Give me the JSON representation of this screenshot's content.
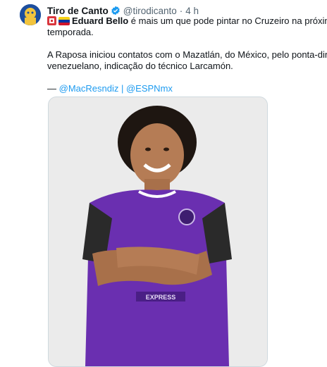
{
  "tweet": {
    "author_name": "Tiro de Canto",
    "handle": "@tirodicanto",
    "separator": "·",
    "time": "4 h",
    "line1_bold": "Eduard Bello",
    "line1_rest": " é mais um que pode pintar no Cruzeiro na próxima",
    "line2": "temporada.",
    "line3": "A Raposa iniciou contatos com o Mazatlán, do México, pelo ponta-direita",
    "line4": "venezuelano, indicação do técnico Larcamón.",
    "credit_prefix": "— ",
    "credit_link1": "@MacResndiz",
    "credit_sep": " | ",
    "credit_link2": "@ESPNmx"
  },
  "media": {
    "description_icon": "player-photo",
    "jersey_text": "EXPRESS",
    "colors": {
      "jersey": "#6a2fb0",
      "sleeve": "#2a2a2a",
      "background": "#ebebeb"
    }
  },
  "colors": {
    "link": "#1d9bf0",
    "verified": "#1d9bf0",
    "muted": "#536471"
  }
}
